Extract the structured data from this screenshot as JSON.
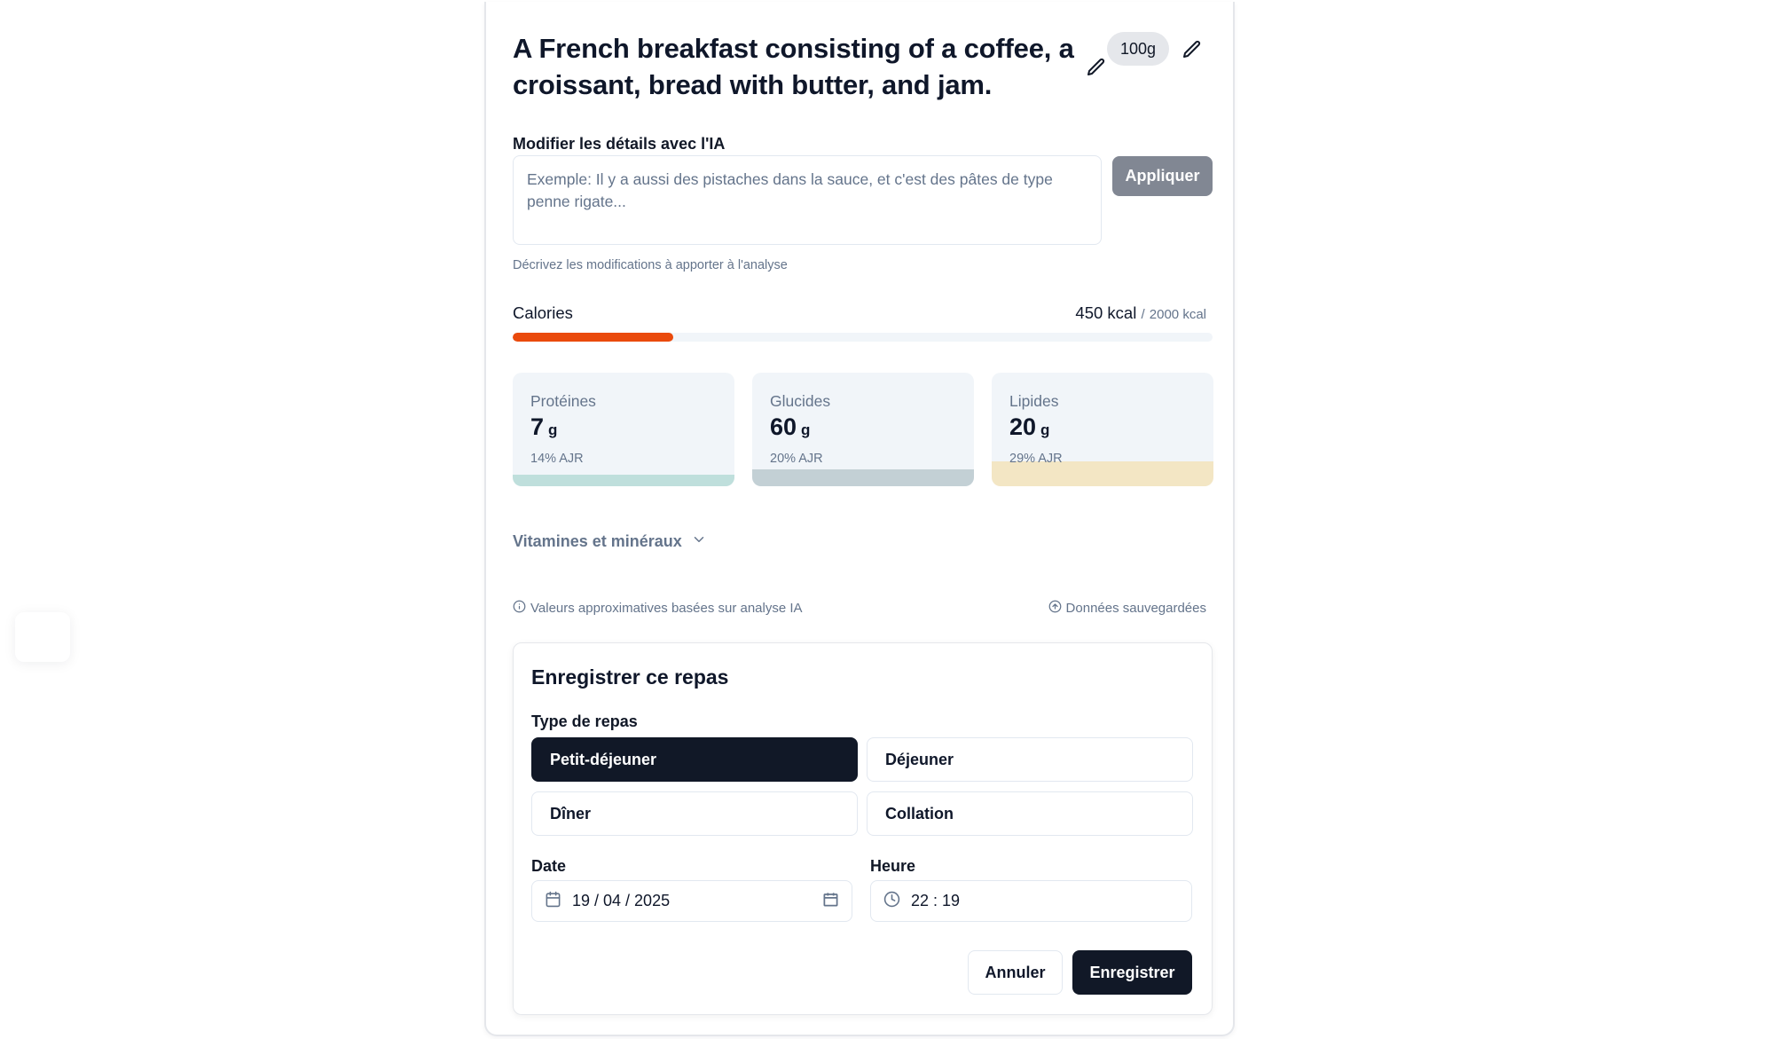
{
  "meal": {
    "title": "A French breakfast consisting of a coffee, a croissant, bread with butter, and jam.",
    "portion": "100g"
  },
  "ai_edit": {
    "label": "Modifier les détails avec l'IA",
    "placeholder": "Exemple: Il y a aussi des pistaches dans la sauce, et c'est des pâtes de type penne rigate...",
    "value": "",
    "apply_label": "Appliquer",
    "hint": "Décrivez les modifications à apporter à l'analyse"
  },
  "calories": {
    "label": "Calories",
    "value": "450 kcal",
    "separator": "/",
    "goal": "2000 kcal",
    "progress": 0.23,
    "color": "#ea4a0c"
  },
  "macros": [
    {
      "name": "Protéines",
      "value": "7",
      "unit": "g",
      "pct_text": "14% AJR",
      "fill": 0.1,
      "color": "#bfdfdc"
    },
    {
      "name": "Glucides",
      "value": "60",
      "unit": "g",
      "pct_text": "20% AJR",
      "fill": 0.15,
      "color": "#c3d0d5"
    },
    {
      "name": "Lipides",
      "value": "20",
      "unit": "g",
      "pct_text": "29% AJR",
      "fill": 0.22,
      "color": "#f3e6c4"
    }
  ],
  "vitamins": {
    "label": "Vitamines et minéraux"
  },
  "footer_info": {
    "left": "Valeurs approximatives basées sur analyse IA",
    "right": "Données sauvegardées"
  },
  "save_panel": {
    "title": "Enregistrer ce repas",
    "type_label": "Type de repas",
    "types": [
      "Petit-déjeuner",
      "Déjeuner",
      "Dîner",
      "Collation"
    ],
    "selected_type": "Petit-déjeuner",
    "date_label": "Date",
    "date_value": "19 / 04 / 2025",
    "time_label": "Heure",
    "time_value": "22 : 19",
    "cancel_label": "Annuler",
    "save_label": "Enregistrer"
  }
}
